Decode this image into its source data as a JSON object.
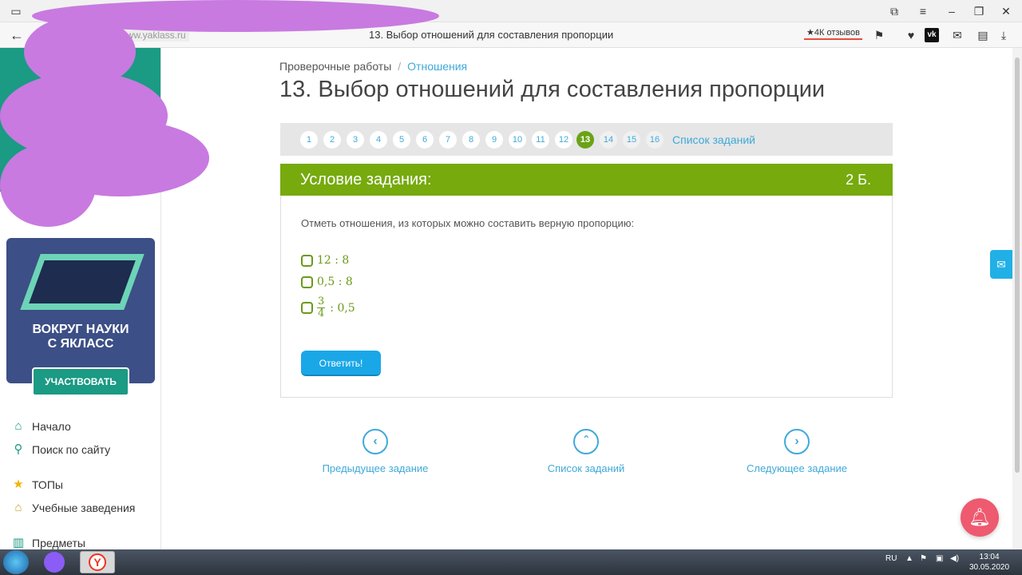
{
  "browser": {
    "url": "www.yaklass.ru",
    "tab_title": "13. Выбор отношений для составления пропорции",
    "reviews": "★4К отзывов"
  },
  "sidebar": {
    "promo_text": "ВОКРУГ НАУКИ С ЯКЛАСС",
    "promo_button": "УЧАСТВОВАТЬ",
    "items": [
      {
        "label": "Начало",
        "icon": "home-icon"
      },
      {
        "label": "Поиск по сайту",
        "icon": "search-icon"
      },
      {
        "label": "ТОПы",
        "icon": "star-icon"
      },
      {
        "label": "Учебные заведения",
        "icon": "building-icon"
      },
      {
        "label": "Предметы",
        "icon": "books-icon"
      }
    ]
  },
  "breadcrumb": {
    "first": "Проверочные работы",
    "second": "Отношения"
  },
  "page_title": "13. Выбор отношений для составления пропорции",
  "pager": {
    "pages": [
      "1",
      "2",
      "3",
      "4",
      "5",
      "6",
      "7",
      "8",
      "9",
      "10",
      "11",
      "12",
      "13",
      "14",
      "15",
      "16"
    ],
    "active": "13",
    "list_label": "Список заданий"
  },
  "task": {
    "header": "Условие задания:",
    "points": "2 Б.",
    "question": "Отметь отношения, из которых можно составить верную пропорцию:",
    "options": [
      {
        "text": "12 : 8"
      },
      {
        "text": "0,5 : 8"
      },
      {
        "num": "3",
        "den": "4",
        "rest": ": 0,5"
      }
    ],
    "answer_button": "Ответить!"
  },
  "navigation": {
    "prev": "Предыдущее задание",
    "list": "Список заданий",
    "next": "Следующее задание"
  },
  "taskbar": {
    "lang": "RU",
    "time": "13:04",
    "date": "30.05.2020"
  },
  "colors": {
    "accent_green": "#76aa0d",
    "link_blue": "#3fa9d9",
    "button_blue": "#1aa7e8",
    "scribble": "#c87ae0"
  }
}
